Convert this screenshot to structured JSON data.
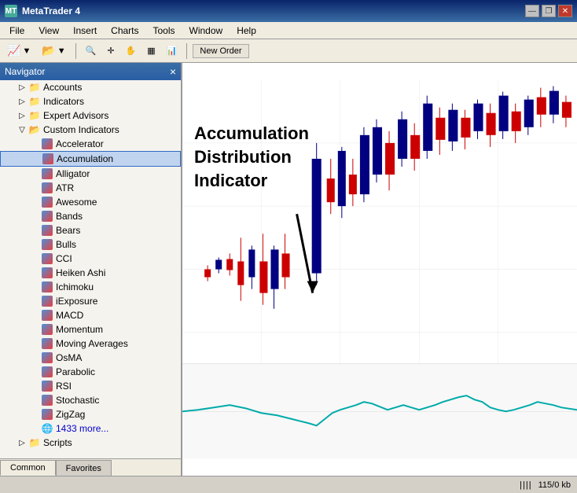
{
  "app": {
    "title": "MetaTrader 4",
    "title_icon": "MT"
  },
  "title_controls": {
    "minimize": "—",
    "restore": "❐",
    "close": "✕"
  },
  "menu": {
    "items": [
      "File",
      "View",
      "Insert",
      "Charts",
      "Tools",
      "Window",
      "Help"
    ]
  },
  "toolbar": {
    "new_order_label": "New Order"
  },
  "navigator": {
    "title": "Navigator",
    "close_label": "×",
    "tree": [
      {
        "id": "accounts",
        "label": "Accounts",
        "indent": 1,
        "type": "folder",
        "expanded": false
      },
      {
        "id": "indicators",
        "label": "Indicators",
        "indent": 1,
        "type": "folder",
        "expanded": false
      },
      {
        "id": "expert-advisors",
        "label": "Expert Advisors",
        "indent": 1,
        "type": "folder",
        "expanded": false
      },
      {
        "id": "custom-indicators",
        "label": "Custom Indicators",
        "indent": 1,
        "type": "folder",
        "expanded": true
      },
      {
        "id": "accelerator",
        "label": "Accelerator",
        "indent": 2,
        "type": "indicator"
      },
      {
        "id": "accumulation",
        "label": "Accumulation",
        "indent": 2,
        "type": "indicator",
        "selected": true
      },
      {
        "id": "alligator",
        "label": "Alligator",
        "indent": 2,
        "type": "indicator"
      },
      {
        "id": "atr",
        "label": "ATR",
        "indent": 2,
        "type": "indicator"
      },
      {
        "id": "awesome",
        "label": "Awesome",
        "indent": 2,
        "type": "indicator"
      },
      {
        "id": "bands",
        "label": "Bands",
        "indent": 2,
        "type": "indicator"
      },
      {
        "id": "bears",
        "label": "Bears",
        "indent": 2,
        "type": "indicator"
      },
      {
        "id": "bulls",
        "label": "Bulls",
        "indent": 2,
        "type": "indicator"
      },
      {
        "id": "cci",
        "label": "CCI",
        "indent": 2,
        "type": "indicator"
      },
      {
        "id": "heiken-ashi",
        "label": "Heiken Ashi",
        "indent": 2,
        "type": "indicator"
      },
      {
        "id": "ichimoku",
        "label": "Ichimoku",
        "indent": 2,
        "type": "indicator"
      },
      {
        "id": "iexposure",
        "label": "iExposure",
        "indent": 2,
        "type": "indicator"
      },
      {
        "id": "macd",
        "label": "MACD",
        "indent": 2,
        "type": "indicator"
      },
      {
        "id": "momentum",
        "label": "Momentum",
        "indent": 2,
        "type": "indicator"
      },
      {
        "id": "moving-averages",
        "label": "Moving Averages",
        "indent": 2,
        "type": "indicator"
      },
      {
        "id": "osma",
        "label": "OsMA",
        "indent": 2,
        "type": "indicator"
      },
      {
        "id": "parabolic",
        "label": "Parabolic",
        "indent": 2,
        "type": "indicator"
      },
      {
        "id": "rsi",
        "label": "RSI",
        "indent": 2,
        "type": "indicator"
      },
      {
        "id": "stochastic",
        "label": "Stochastic",
        "indent": 2,
        "type": "indicator"
      },
      {
        "id": "zigzag",
        "label": "ZigZag",
        "indent": 2,
        "type": "indicator"
      },
      {
        "id": "more",
        "label": "1433 more...",
        "indent": 2,
        "type": "more"
      },
      {
        "id": "scripts",
        "label": "Scripts",
        "indent": 1,
        "type": "folder",
        "expanded": false
      }
    ]
  },
  "annotation": {
    "line1": "Accumulation",
    "line2": "Distribution",
    "line3": "Indicator"
  },
  "bottom_tabs": [
    {
      "id": "common",
      "label": "Common",
      "active": true
    },
    {
      "id": "favorites",
      "label": "Favorites",
      "active": false
    }
  ],
  "status_bar": {
    "bars_icon": "||||",
    "memory": "115/0 kb"
  }
}
